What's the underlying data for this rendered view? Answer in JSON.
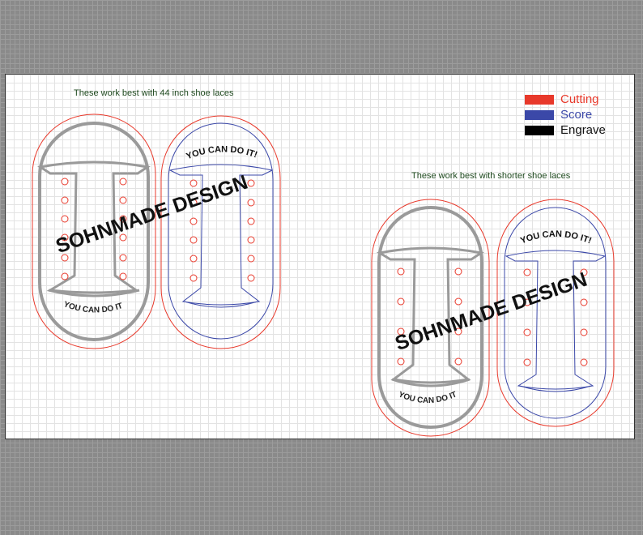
{
  "captions": {
    "long_laces": "These work best with 44 inch shoe laces",
    "short_laces": "These work best with shorter shoe laces"
  },
  "legend": [
    {
      "label": "Cutting",
      "color": "#e8392b",
      "text_color": "#e8392b"
    },
    {
      "label": "Score",
      "color": "#3b48a8",
      "text_color": "#3b48a8"
    },
    {
      "label": "Engrave",
      "color": "#000000",
      "text_color": "#111111"
    }
  ],
  "shoe_text": {
    "gray_large": "YOU CAN DO IT",
    "blue_large": "YOU CAN DO IT!",
    "gray_small": "YOU CAN DO IT",
    "blue_small": "YOU CAN DO IT!"
  },
  "watermark": "SOHNMADE DESIGN",
  "colors": {
    "cutting": "#e8392b",
    "score": "#3b48a8",
    "engrave_gray": "#9a9a9a",
    "eyelet": "#e8392b"
  }
}
